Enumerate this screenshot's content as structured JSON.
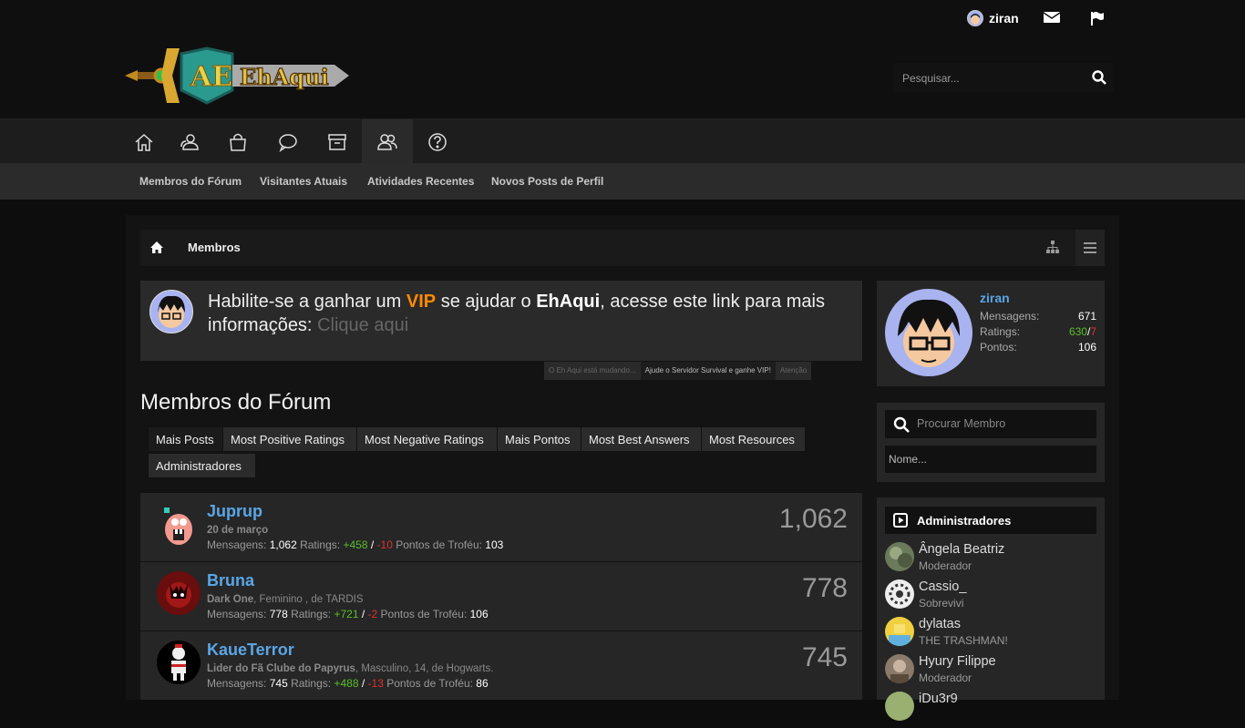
{
  "colors": {
    "accent": "#5aa6e6",
    "vip": "#ff8a00",
    "positive": "#5bbf2a",
    "negative": "#e03030"
  },
  "topbar": {
    "username": "ziran",
    "icons": [
      "envelope-icon",
      "flag-icon"
    ]
  },
  "header": {
    "logo_text": "EhAqui",
    "logo_badge": "AE",
    "search_placeholder": "Pesquisar..."
  },
  "nav": {
    "tabs": [
      "home-icon",
      "users-icon",
      "shopping-bag-icon",
      "chat-icon",
      "archive-icon",
      "members-icon",
      "help-icon"
    ],
    "active": "members-icon"
  },
  "subnav": [
    "Membros do Fórum",
    "Visitantes Atuais",
    "Atividades Recentes",
    "Novos Posts de Perfil"
  ],
  "breadcrumb": {
    "label": "Membros"
  },
  "notice": {
    "t1": "Habilite-se a ganhar um ",
    "vip": "VIP",
    "t2": " se ajudar o ",
    "brand": "EhAqui",
    "t3": ", acesse este link para mais informações: ",
    "link": "Clique aqui",
    "tabs": [
      "O Eh Aqui está mudando...",
      "Ajude o Servidor Survival e ganhe VIP!",
      "Atenção"
    ]
  },
  "page_title": "Membros do Fórum",
  "tabs": [
    "Mais Posts",
    "Most Positive Ratings",
    "Most Negative Ratings",
    "Mais Pontos",
    "Most Best Answers",
    "Most Resources",
    "Administradores"
  ],
  "members": [
    {
      "name": "Juprup",
      "info_bold": "20 de março",
      "info_rest": "",
      "messages": "1,062",
      "pos": "+458",
      "neg": "-10",
      "trophy": "103",
      "count": "1,062"
    },
    {
      "name": "Bruna",
      "info_bold": "Dark One",
      "info_rest": ", Feminino , de TARDIS",
      "messages": "778",
      "pos": "+721",
      "neg": "-2",
      "trophy": "106",
      "count": "778"
    },
    {
      "name": "KaueTerror",
      "info_bold": "Lider do Fã Clube do Papyrus",
      "info_rest": ", Masculino, 14, de Hogwarts.",
      "messages": "745",
      "pos": "+488",
      "neg": "-13",
      "trophy": "86",
      "count": "745"
    }
  ],
  "labels": {
    "messages": "Mensagens:",
    "ratings": "Ratings:",
    "trophy": "Pontos de Troféu:",
    "slash": "/"
  },
  "profile": {
    "name": "ziran",
    "messages_label": "Mensagens:",
    "messages": "671",
    "ratings_label": "Ratings:",
    "ratings_pos": "630",
    "ratings_sep": "/",
    "ratings_neg": "7",
    "points_label": "Pontos:",
    "points": "106"
  },
  "find_member": {
    "title": "Procurar Membro",
    "placeholder": "Nome..."
  },
  "admins": {
    "title": "Administradores",
    "list": [
      {
        "name": "Ângela Beatriz",
        "role": "Moderador"
      },
      {
        "name": "Cassio_",
        "role": "Sobrevivi"
      },
      {
        "name": "dylatas",
        "role": "THE TRASHMAN!"
      },
      {
        "name": "Hyury Filippe",
        "role": "Moderador"
      },
      {
        "name": "iDu3r9",
        "role": ""
      }
    ]
  }
}
